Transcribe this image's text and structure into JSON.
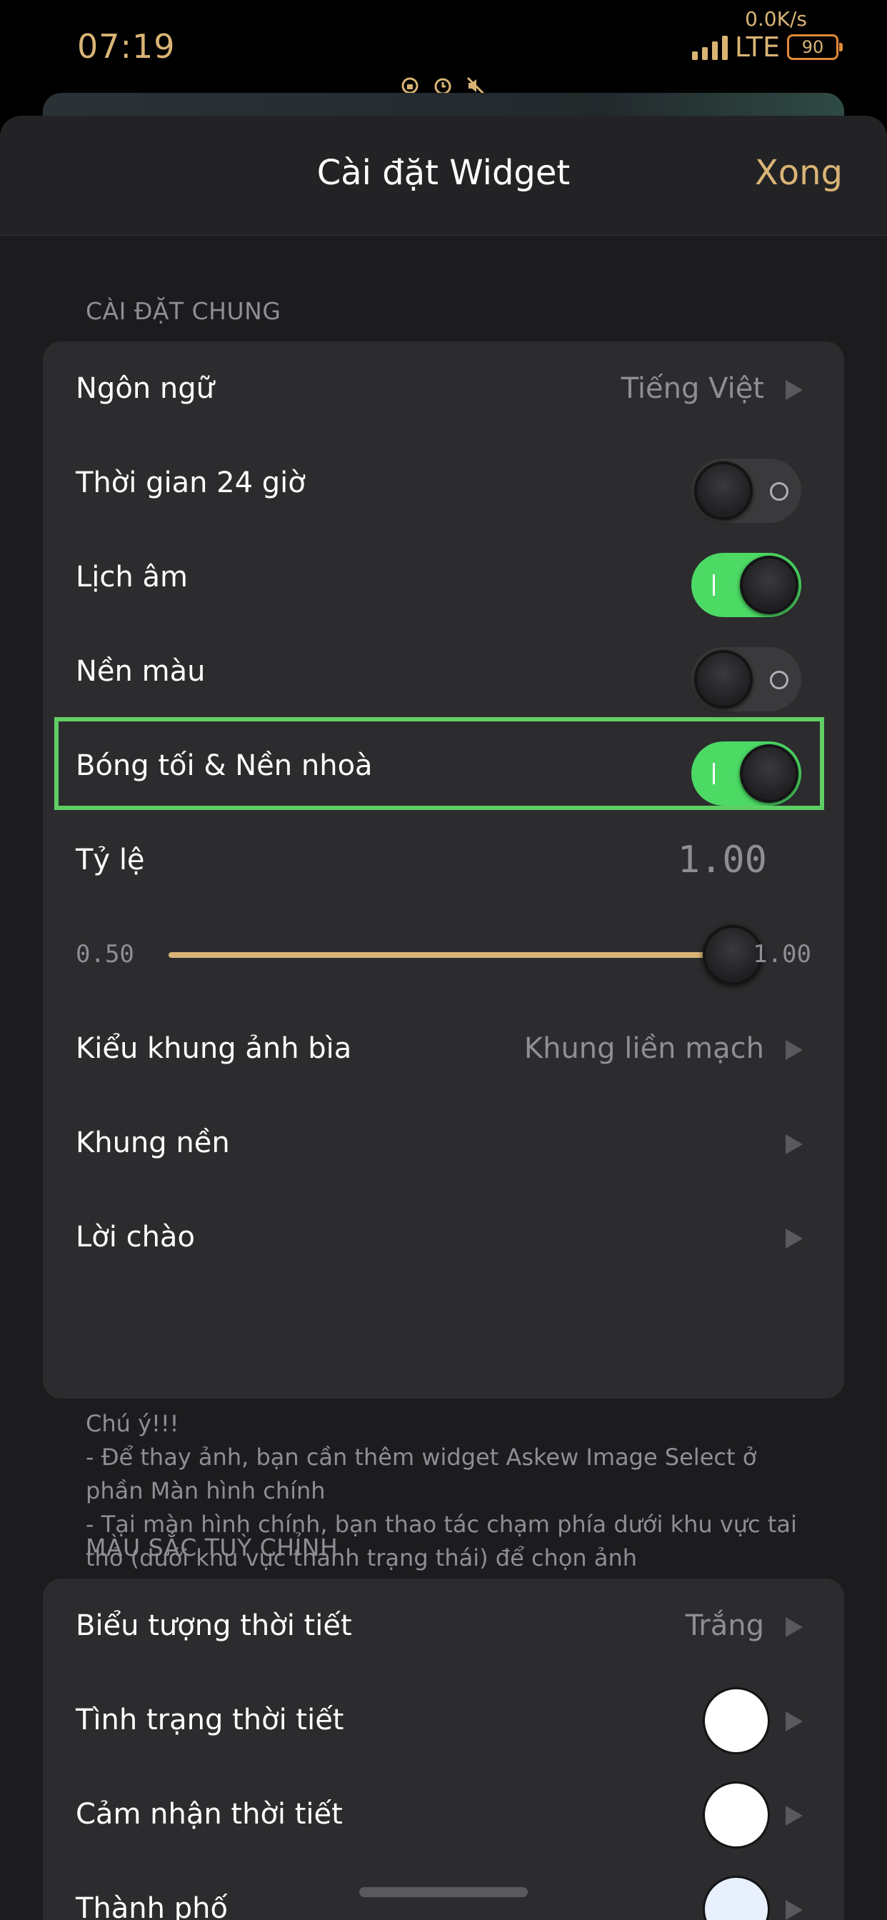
{
  "status_bar": {
    "time": "07:19",
    "net_speed": "0.0K/s",
    "network": "LTE",
    "battery": "90",
    "icons": [
      "rotation-lock-icon",
      "alarm-icon",
      "silent-icon"
    ]
  },
  "header": {
    "title": "Cài đặt Widget",
    "done_label": "Xong"
  },
  "general_section": {
    "title": "CÀI ĐẶT CHUNG",
    "language_label": "Ngôn ngữ",
    "language_value": "Tiếng Việt",
    "time24_label": "Thời gian 24 giờ",
    "time24_on": false,
    "lunar_label": "Lịch âm",
    "lunar_on": true,
    "bg_color_label": "Nền màu",
    "bg_color_on": false,
    "shadow_blur_label": "Bóng tối & Nền nhoà",
    "shadow_blur_on": true,
    "scale_label": "Tỷ lệ",
    "scale_value": "1.00",
    "slider_min": "0.50",
    "slider_max": "1.00",
    "slider_fraction": 1.0,
    "cover_frame_label": "Kiểu khung ảnh bìa",
    "cover_frame_value": "Khung liền mạch",
    "background_frame_label": "Khung nền",
    "greeting_label": "Lời chào"
  },
  "note": {
    "line1": "Chú ý!!!",
    "line2": "- Để thay ảnh, bạn cần thêm widget Askew Image Select ở phần Màn hình chính",
    "line3": "- Tại màn hình chính, bạn thao tác chạm phía dưới khu vực tai thỏ (dưới khu vực thanh trạng thái) để chọn ảnh"
  },
  "custom_colors_section": {
    "title": "MÀU SẮC TUỲ CHỈNH",
    "weather_icon_label": "Biểu tượng thời tiết",
    "weather_icon_value": "Trắng",
    "weather_status_label": "Tình trạng thời tiết",
    "weather_status_color": "#ffffff",
    "weather_feel_label": "Cảm nhận thời tiết",
    "weather_feel_color": "#ffffff",
    "city_label": "Thành phố",
    "city_color": "#e8f0fe"
  },
  "colors": {
    "accent": "#d9b475",
    "toggle_on": "#4cd964",
    "highlight": "#5fcf65"
  }
}
